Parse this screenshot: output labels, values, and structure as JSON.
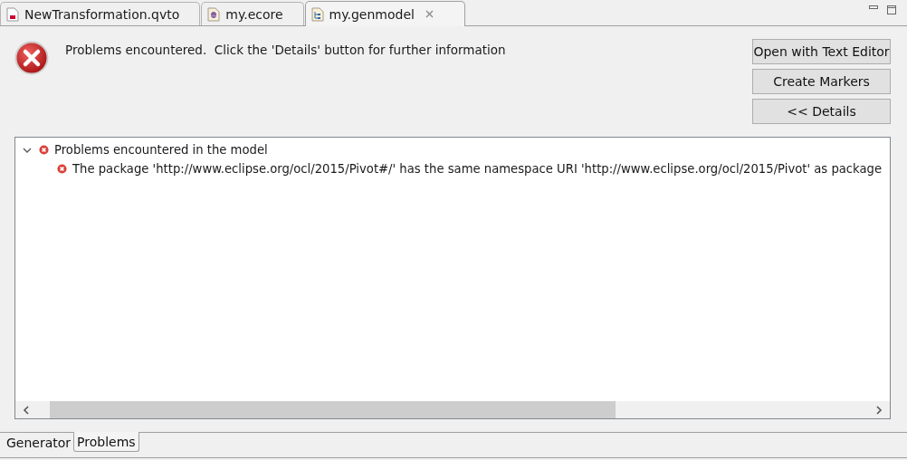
{
  "editor_tabs": [
    {
      "label": "NewTransformation.qvto",
      "kind": "qvto",
      "selected": false
    },
    {
      "label": "my.ecore",
      "kind": "ecore",
      "selected": false
    },
    {
      "label": "my.genmodel",
      "kind": "genmodel",
      "selected": true
    }
  ],
  "message": "Problems encountered.  Click the 'Details' button for further information",
  "buttons": [
    "Open with Text Editor",
    "Create Markers",
    "<< Details"
  ],
  "tree": [
    {
      "label": "Problems encountered in the model",
      "expanded": true,
      "children": [
        {
          "label": "The package 'http://www.eclipse.org/ocl/2015/Pivot#/' has the same namespace URI 'http://www.eclipse.org/ocl/2015/Pivot' as package"
        }
      ]
    }
  ],
  "bottom_tabs": [
    {
      "label": "Generator",
      "selected": false
    },
    {
      "label": "Problems",
      "selected": true
    }
  ]
}
